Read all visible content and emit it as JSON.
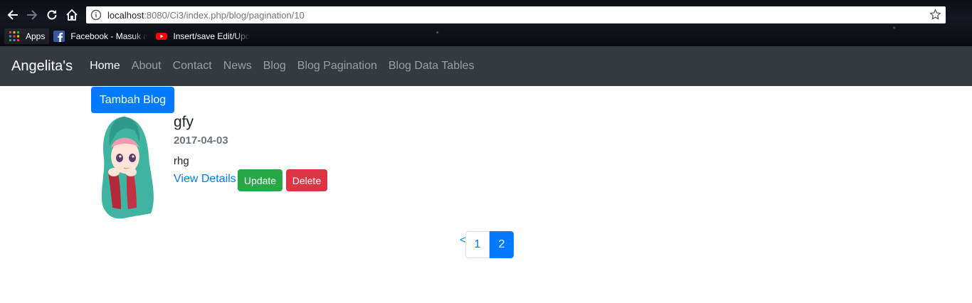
{
  "browser": {
    "url_host": "localhost",
    "url_rest": ":8080/Ci3/index.php/blog/pagination/10",
    "icons": {
      "back": "back-arrow-icon",
      "forward": "forward-arrow-icon",
      "reload": "reload-icon",
      "home": "home-icon",
      "info": "info-icon",
      "bookmark_star": "star-icon"
    },
    "bookmarks": [
      {
        "label": "Apps",
        "icon": "apps-grid-icon"
      },
      {
        "label": "Facebook - Masuk atau Daftar",
        "icon": "facebook-icon"
      },
      {
        "label": "Insert/save Edit/Update",
        "icon": "youtube-icon"
      }
    ]
  },
  "navbar": {
    "brand": "Angelita's",
    "links": [
      "Home",
      "About",
      "Contact",
      "News",
      "Blog",
      "Blog Pagination",
      "Blog Data Tables"
    ],
    "active_index": 0
  },
  "actions": {
    "add_blog": "Tambah Blog"
  },
  "post": {
    "title": "gfy",
    "date": "2017-04-03",
    "body": "rhg",
    "view_details": "View Details",
    "update": "Update",
    "delete": "Delete",
    "image": "hijab-girl-avatar"
  },
  "pagination": {
    "prev": "<",
    "pages": [
      "1",
      "2"
    ],
    "current": "2"
  },
  "colors": {
    "primary": "#007bff",
    "success": "#28a745",
    "danger": "#dc3545",
    "navbar_bg": "#343a40"
  }
}
